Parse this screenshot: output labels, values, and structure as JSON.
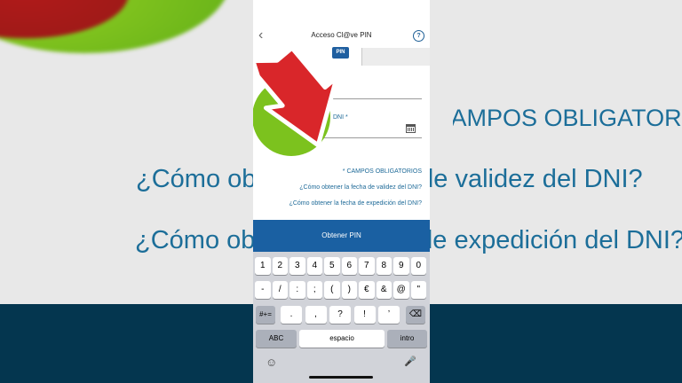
{
  "background": {
    "line1": "* CAMPOS OBLIGATORIOS",
    "line2": "¿Cómo obtener la fecha de validez del DNI?",
    "line3": "¿Cómo obtener la fecha de expedición del DNI?"
  },
  "nav": {
    "back_icon": "‹",
    "title": "Acceso Cl@ve PIN",
    "help_icon": "?"
  },
  "tabs": {
    "pin_badge": "PIN"
  },
  "form": {
    "dni_label": "DNI",
    "date_label": "DNI *"
  },
  "links": {
    "required": "* CAMPOS OBLIGATORIOS",
    "validity": "¿Cómo obtener la fecha de validez del DNI?",
    "issue": "¿Cómo obtener la fecha de expedición del DNI?"
  },
  "cta": {
    "label": "Obtener PIN"
  },
  "keyboard": {
    "row1": [
      "1",
      "2",
      "3",
      "4",
      "5",
      "6",
      "7",
      "8",
      "9",
      "0"
    ],
    "row2": [
      "-",
      "/",
      ":",
      ";",
      "(",
      ")",
      "€",
      "&",
      "@",
      "\""
    ],
    "row3_mode": "#+=",
    "row3": [
      ".",
      ",",
      "?",
      "!",
      "’"
    ],
    "row3_delete": "⌫",
    "row4_abc": "ABC",
    "row4_space": "espacio",
    "row4_return": "intro",
    "emoji_icon": "☺",
    "mic_icon": "🎤"
  },
  "colors": {
    "accent": "#1a60a2",
    "link": "#1e6a98",
    "arrow": "#d9262a",
    "green": "#7cc21e"
  }
}
